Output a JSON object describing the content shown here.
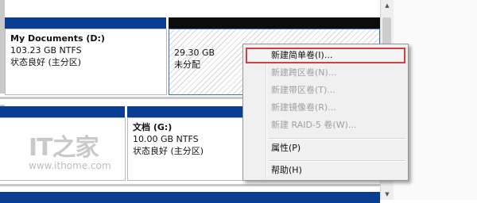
{
  "disk_top": {
    "partitions": [
      {
        "name": "My Documents  (D:)",
        "size": "103.23 GB NTFS",
        "status": "状态良好 (主分区)"
      },
      {
        "size": "29.30 GB",
        "status": "未分配"
      }
    ]
  },
  "disk_middle": {
    "partitions": [
      {
        "name": "文档  (G:)",
        "size": "10.00 GB NTFS",
        "status": "状态良好 (主分区)"
      }
    ]
  },
  "context_menu": {
    "items": [
      {
        "label": "新建简单卷(I)...",
        "enabled": true,
        "highlighted": true
      },
      {
        "label": "新建跨区卷(N)...",
        "enabled": false
      },
      {
        "label": "新建带区卷(T)...",
        "enabled": false
      },
      {
        "label": "新建镜像卷(R)...",
        "enabled": false
      },
      {
        "label": "新建 RAID-5 卷(W)...",
        "enabled": false
      },
      {
        "label": "属性(P)",
        "enabled": true
      },
      {
        "label": "帮助(H)",
        "enabled": true
      }
    ]
  },
  "watermark": {
    "logo": "IT之家",
    "url": "www.ithome.com"
  },
  "colors": {
    "header_blue": "#0b3d91",
    "header_black": "#0c0c0c",
    "highlight_border": "#d04040"
  }
}
